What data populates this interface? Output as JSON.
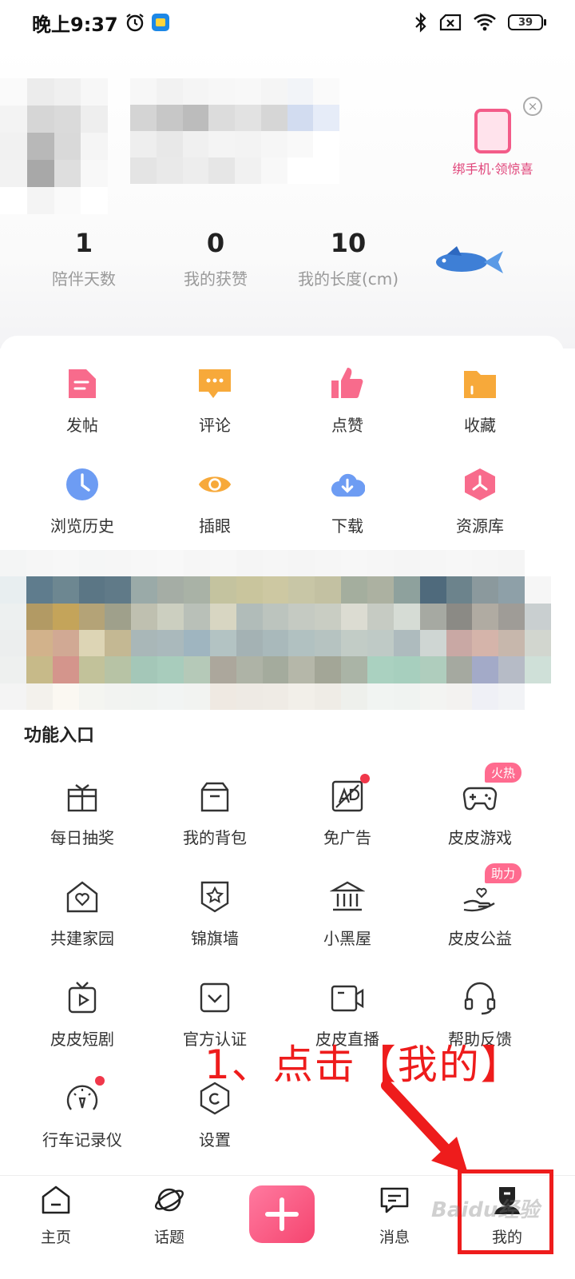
{
  "status_bar": {
    "time": "晚上9:37",
    "battery": "39",
    "icons": [
      "alarm-icon",
      "app-notification-icon",
      "bluetooth-icon",
      "sim-icon",
      "wifi-icon",
      "battery-icon"
    ]
  },
  "profile": {
    "bind_phone_label": "绑手机·领惊喜",
    "close_symbol": "×",
    "stats": [
      {
        "value": "1",
        "label": "陪伴天数"
      },
      {
        "value": "0",
        "label": "我的获赞"
      },
      {
        "value": "10",
        "label": "我的长度(cm)"
      }
    ]
  },
  "quick_actions": [
    {
      "label": "发帖",
      "icon": "post-icon",
      "color": "#f86b8c"
    },
    {
      "label": "评论",
      "icon": "comment-icon",
      "color": "#f7a93a"
    },
    {
      "label": "点赞",
      "icon": "like-icon",
      "color": "#f86b8c"
    },
    {
      "label": "收藏",
      "icon": "favorite-folder-icon",
      "color": "#f7a93a"
    },
    {
      "label": "浏览历史",
      "icon": "history-clock-icon",
      "color": "#6d9cf3"
    },
    {
      "label": "插眼",
      "icon": "eye-icon",
      "color": "#f7a93a"
    },
    {
      "label": "下载",
      "icon": "download-cloud-icon",
      "color": "#6d9cf3"
    },
    {
      "label": "资源库",
      "icon": "resource-hexagon-icon",
      "color": "#f86b8c"
    }
  ],
  "features": {
    "title": "功能入口",
    "items": [
      {
        "label": "每日抽奖",
        "icon": "gift-icon"
      },
      {
        "label": "我的背包",
        "icon": "backpack-box-icon"
      },
      {
        "label": "免广告",
        "icon": "no-ads-icon",
        "dot": true
      },
      {
        "label": "皮皮游戏",
        "icon": "gamepad-icon",
        "badge": "火热"
      },
      {
        "label": "共建家园",
        "icon": "home-heart-icon"
      },
      {
        "label": "锦旗墙",
        "icon": "star-badge-icon"
      },
      {
        "label": "小黑屋",
        "icon": "bank-building-icon"
      },
      {
        "label": "皮皮公益",
        "icon": "charity-hand-icon",
        "badge": "助力"
      },
      {
        "label": "皮皮短剧",
        "icon": "tv-play-icon"
      },
      {
        "label": "官方认证",
        "icon": "verified-check-icon"
      },
      {
        "label": "皮皮直播",
        "icon": "video-camera-icon"
      },
      {
        "label": "帮助反馈",
        "icon": "headset-icon"
      },
      {
        "label": "行车记录仪",
        "icon": "speedometer-icon",
        "dot": true
      },
      {
        "label": "设置",
        "icon": "settings-hexagon-icon"
      }
    ]
  },
  "annotation": {
    "text": "1、点击【我的】"
  },
  "bottom_nav": {
    "items": [
      {
        "label": "主页",
        "icon": "home-icon"
      },
      {
        "label": "话题",
        "icon": "planet-icon"
      },
      {
        "label": "",
        "icon": "plus-icon"
      },
      {
        "label": "消息",
        "icon": "message-icon"
      },
      {
        "label": "我的",
        "icon": "profile-icon"
      }
    ]
  },
  "watermark": "Baidu经验"
}
